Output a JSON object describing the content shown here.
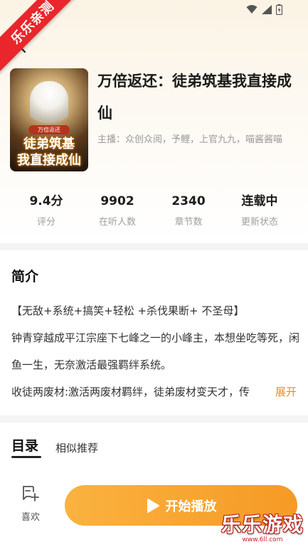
{
  "badge": {
    "text": "乐乐亲测"
  },
  "book": {
    "cover_subtitle": "万倍返还",
    "cover_title_line1": "徒弟筑基",
    "cover_title_line2": "我直接成仙",
    "title": "万倍返还：徒弟筑基我直接成仙",
    "anchors": "主播：众创众阅，予鲤，上官九九，喵酱酱喵"
  },
  "stats": [
    {
      "value": "9.4分",
      "label": "评分"
    },
    {
      "value": "9902",
      "label": "在听人数"
    },
    {
      "value": "2340",
      "label": "章节数"
    },
    {
      "value": "连载中",
      "label": "更新状态"
    }
  ],
  "intro": {
    "heading": "简介",
    "tags": "【无敌+系统+搞笑+轻松 +杀伐果断+ 不圣母】",
    "para1": "钟青穿越成平江宗座下七峰之一的小峰主，本想坐吃等死，闲鱼一生，无奈激活最强羁绊系统。",
    "para2": "收徒两废材:激活两废材羁绊，徒弟废材变天才，传",
    "expand": "展开"
  },
  "tabs": {
    "catalog": "目录",
    "related": "相似推荐"
  },
  "bottom": {
    "like_label": "喜欢",
    "play_label": "开始播放"
  },
  "watermark": {
    "name": "乐乐游戏",
    "url": "www.6ll.com"
  },
  "colors": {
    "accent": "#f59a25",
    "expand": "#f0891d",
    "badge": "#e8262b"
  }
}
